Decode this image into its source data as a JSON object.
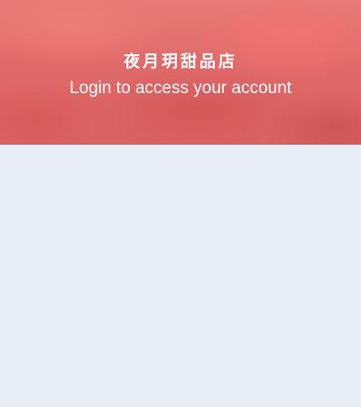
{
  "header": {
    "store_name": "夜月玥甜品店",
    "subtitle": "Login to access your account"
  },
  "colors": {
    "hero_base": "#e06d6c",
    "page_background": "#e9edf5",
    "text": "#ffffff"
  }
}
